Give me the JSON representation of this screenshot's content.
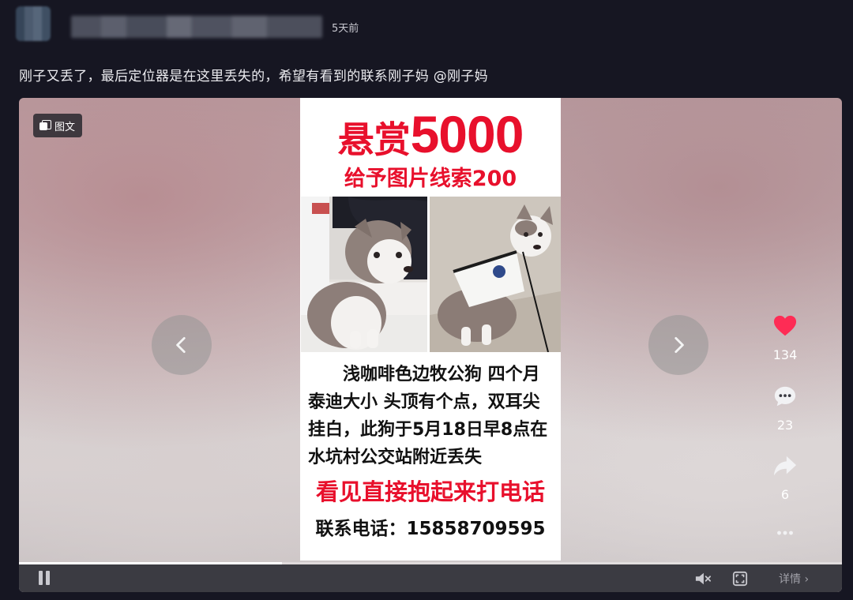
{
  "post": {
    "time": "5天前",
    "caption": "刚子又丢了，最后定位器是在这里丢失的，希望有看到的联系刚子妈 @刚子妈"
  },
  "media": {
    "tag_label": "图文",
    "poster": {
      "reward_cn": "悬赏",
      "reward_amount": "5000",
      "clue_line": "给予图片线索200",
      "description_lines": [
        "浅咖啡色边牧公狗 四个月",
        "泰迪大小 头顶有个点，双耳尖",
        "挂白，此狗于5月18日早8点在",
        "水坑村公交站附近丢失"
      ],
      "action_line": "看见直接抱起来打电话",
      "contact_line": "联系电话：15858709595"
    },
    "progress": 0.32,
    "detail_label": "详情 ›"
  },
  "actions": {
    "likes": "134",
    "comments": "23",
    "shares": "6"
  },
  "colors": {
    "accent_red": "#e8102c",
    "like_pink": "#fe2c55"
  }
}
